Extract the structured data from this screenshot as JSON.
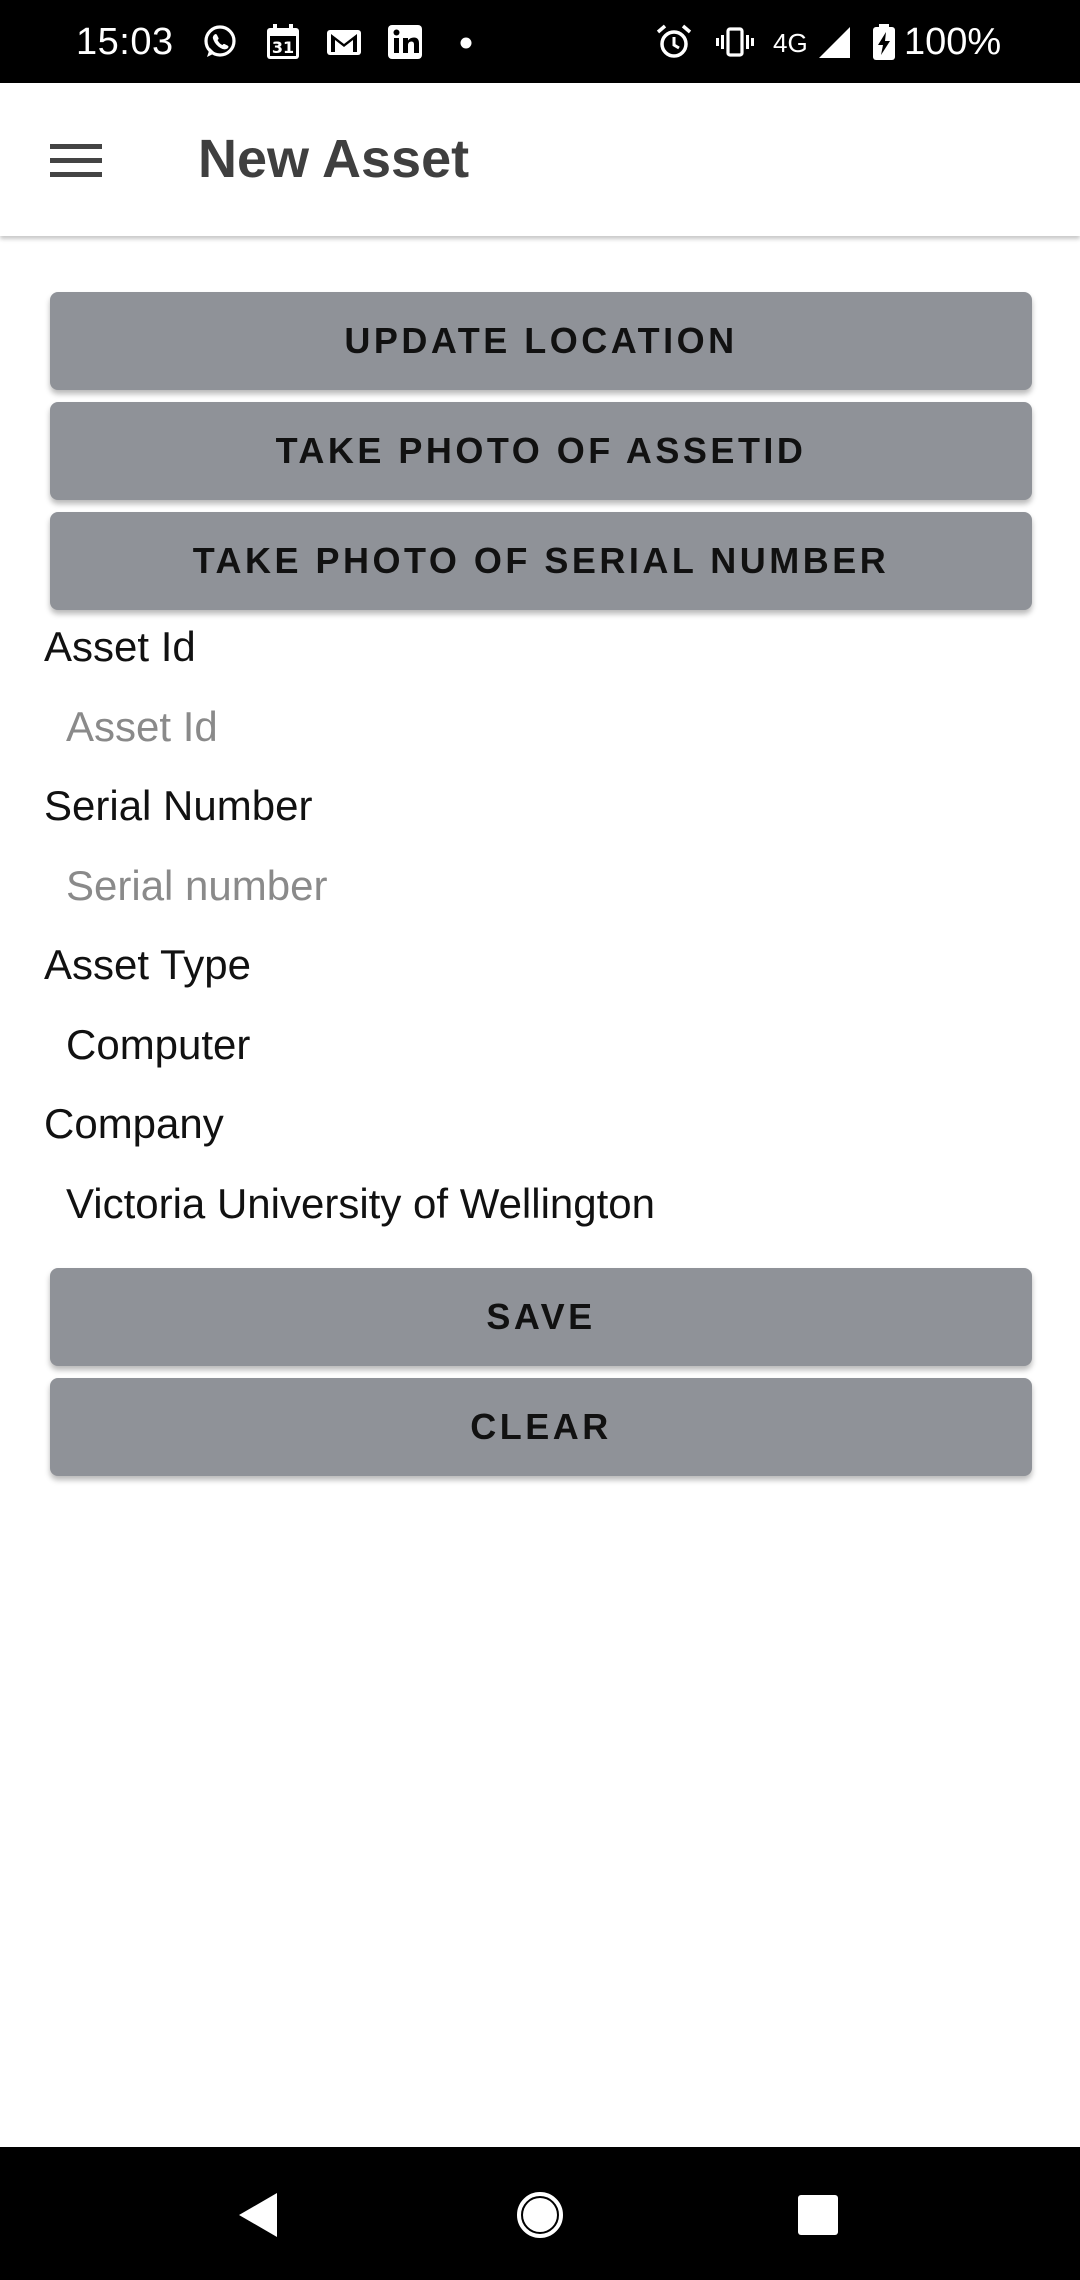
{
  "status_bar": {
    "time": "15:03",
    "network": "4G",
    "battery": "100%",
    "left_icons": [
      "whatsapp-icon",
      "calendar-icon",
      "gmail-icon",
      "linkedin-icon",
      "dot-icon"
    ],
    "right_icons": [
      "alarm-icon",
      "vibrate-icon",
      "signal-icon",
      "battery-charging-icon"
    ],
    "calendar_day": "31"
  },
  "app_bar": {
    "title": "New Asset",
    "menu_icon": "menu-icon"
  },
  "actions": {
    "update_location": "UPDATE LOCATION",
    "take_photo_assetid": "TAKE PHOTO OF ASSETID",
    "take_photo_serial": "TAKE PHOTO OF SERIAL NUMBER"
  },
  "form": {
    "asset_id": {
      "label": "Asset Id",
      "value": "",
      "placeholder": "Asset Id"
    },
    "serial_number": {
      "label": "Serial Number",
      "value": "",
      "placeholder": "Serial number"
    },
    "asset_type": {
      "label": "Asset Type",
      "value": "Computer"
    },
    "company": {
      "label": "Company",
      "value": "Victoria University of Wellington"
    }
  },
  "buttons": {
    "save": "SAVE",
    "clear": "CLEAR"
  },
  "nav_bar": {
    "icons": [
      "back-icon",
      "home-icon",
      "recents-icon"
    ]
  },
  "colors": {
    "button_bg": "#8f9298",
    "status_bar_bg": "#000000",
    "title_color": "#3f3f3f",
    "placeholder_color": "#8a8a8a"
  }
}
